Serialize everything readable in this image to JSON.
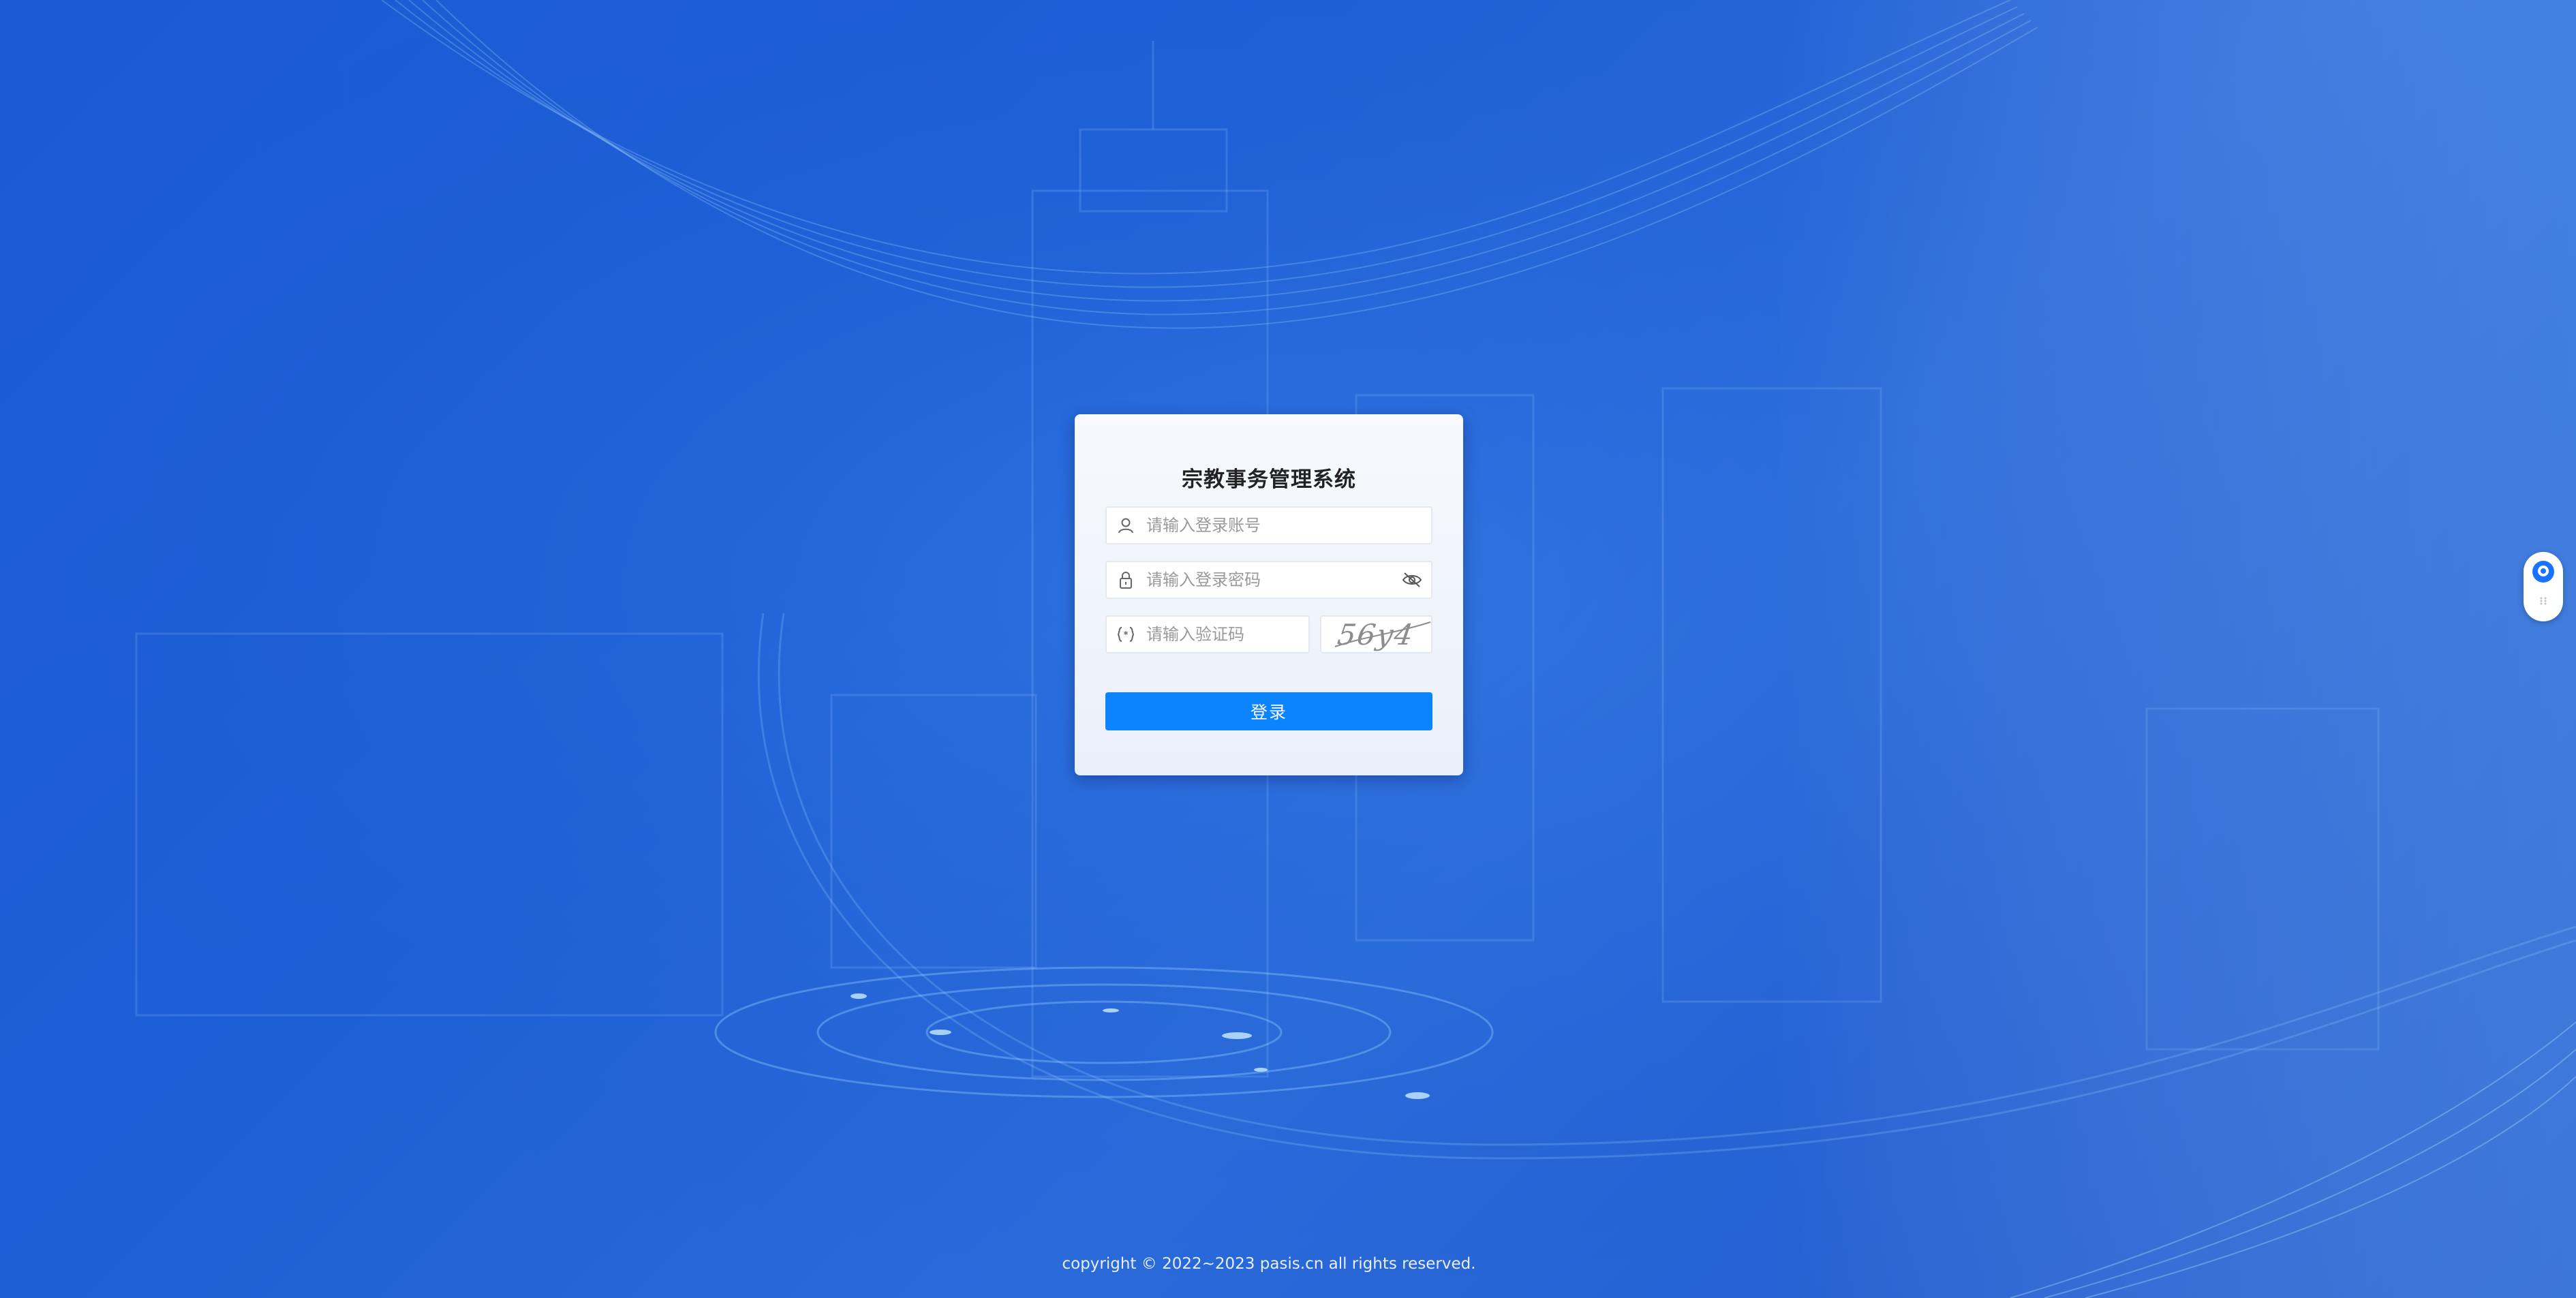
{
  "login": {
    "title": "宗教事务管理系统",
    "username_placeholder": "请输入登录账号",
    "password_placeholder": "请输入登录密码",
    "captcha_placeholder": "请输入验证码",
    "captcha_text": "56y4",
    "submit_label": "登录"
  },
  "icons": {
    "username": "user-icon",
    "password": "lock-icon",
    "captcha": "code-braces-icon",
    "toggle_password": "eye-off-icon",
    "side_widget": "assistant-icon"
  },
  "footer": {
    "copyright": "copyright © 2022~2023 pasis.cn all rights reserved."
  },
  "colors": {
    "background": "#1f5fd6",
    "card": "#f2f5fb",
    "button": "#0c84ff",
    "button_text": "#ffffff"
  }
}
